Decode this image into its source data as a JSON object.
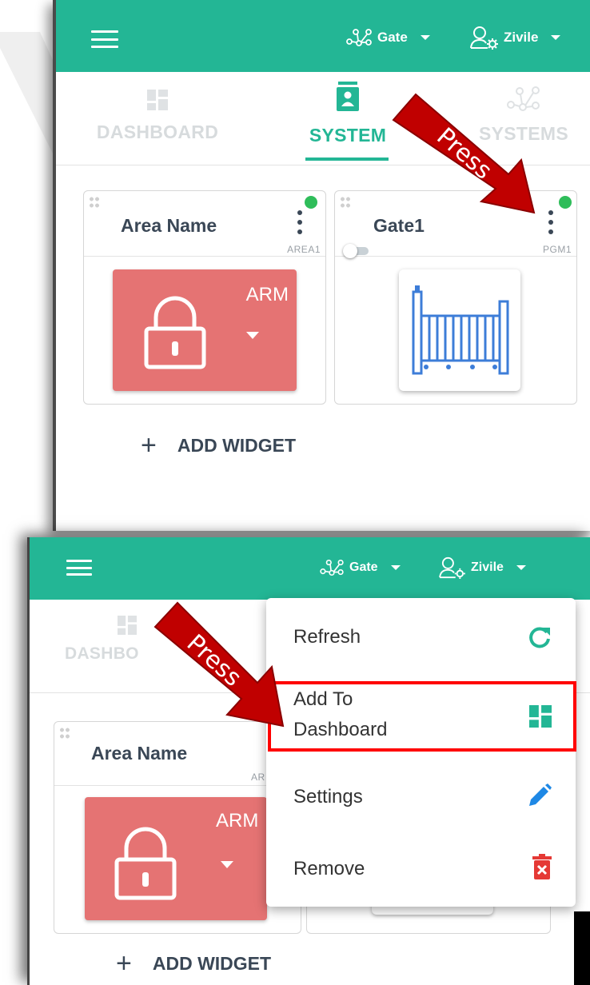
{
  "colors": {
    "accent": "#23b695",
    "arm_red": "#e57373",
    "status_green": "#2fbd5a",
    "annotation_red": "#c00000"
  },
  "screen1": {
    "topbar": {
      "menu_icon": "hamburger-icon",
      "system_name": "Gate",
      "system_icon": "network-icon",
      "user_name": "Zivile",
      "user_icon": "user-gear-icon"
    },
    "tabs": [
      {
        "label": "DASHBOARD",
        "icon": "dashboard-icon",
        "active": false
      },
      {
        "label": "SYSTEM",
        "icon": "system-icon",
        "active": true
      },
      {
        "label": "SYSTEMS",
        "icon": "network-icon",
        "active": false
      }
    ],
    "widgets": [
      {
        "title": "Area Name",
        "tag": "AREA1",
        "button_label": "ARM",
        "status": "online"
      },
      {
        "title": "Gate1",
        "tag": "PGM1",
        "status": "online",
        "toggle": "off"
      }
    ],
    "add_widget": "ADD WIDGET",
    "annotation": "Press"
  },
  "screen2": {
    "topbar": {
      "menu_icon": "hamburger-icon",
      "system_name": "Gate",
      "user_name": "Zivile"
    },
    "tab_partial": "DASHBO",
    "widget": {
      "title": "Area Name",
      "tag_partial": "AR",
      "button_label": "ARM"
    },
    "add_widget": "ADD WIDGET",
    "annotation": "Press",
    "menu": [
      {
        "label": "Refresh",
        "icon": "refresh-icon",
        "icon_color": "#23b695"
      },
      {
        "label_line1": "Add To",
        "label_line2": "Dashboard",
        "icon": "dashboard-icon",
        "icon_color": "#23b695",
        "highlighted": true
      },
      {
        "label": "Settings",
        "icon": "pencil-icon",
        "icon_color": "#1e88e5"
      },
      {
        "label": "Remove",
        "icon": "trash-icon",
        "icon_color": "#e53935"
      }
    ]
  }
}
